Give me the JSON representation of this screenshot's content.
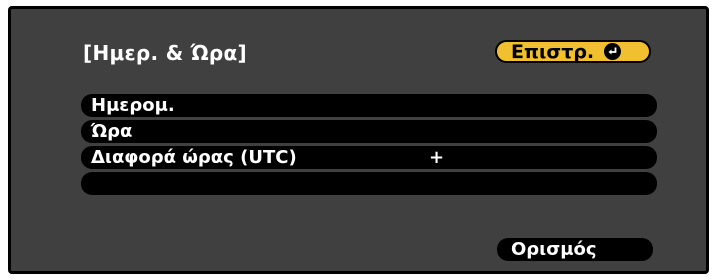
{
  "dialog": {
    "title": "[Ημερ. & Ώρα]",
    "back_label": "Επιστρ."
  },
  "menu": {
    "items": [
      {
        "label": "Ημερομ.",
        "value": ""
      },
      {
        "label": "Ώρα",
        "value": ""
      },
      {
        "label": "Διαφορά ώρας (UTC)",
        "value": "+"
      },
      {
        "label": "",
        "value": ""
      }
    ]
  },
  "footer": {
    "ok_label": "Ορισμός"
  },
  "colors": {
    "background": "#404040",
    "highlight": "#f0c030",
    "row": "#000000",
    "text": "#ffffff"
  },
  "icons": {
    "back_button_icon": "enter-return-icon"
  }
}
